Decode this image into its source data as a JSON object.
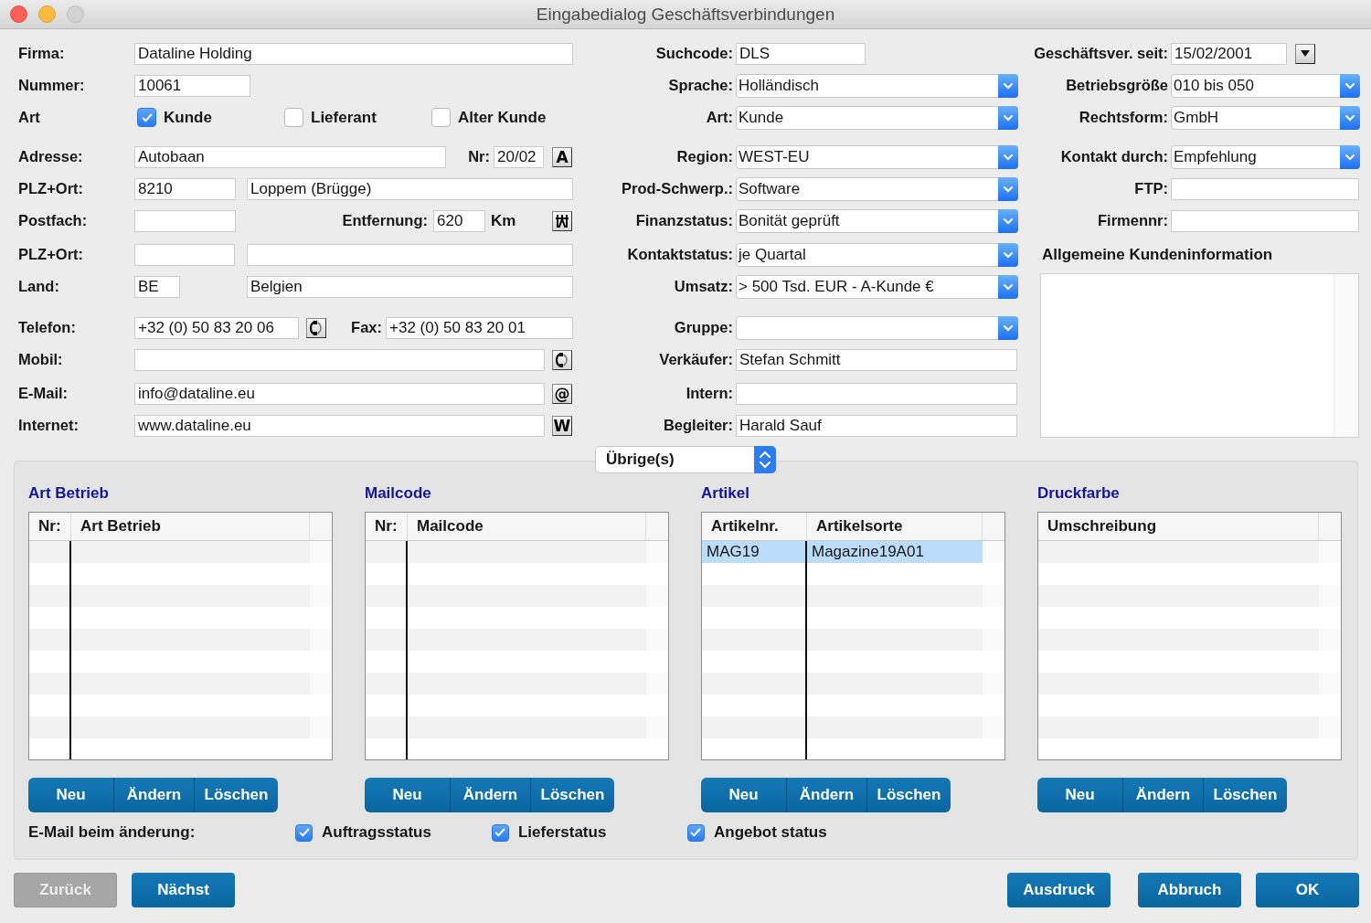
{
  "window": {
    "title": "Eingabedialog Geschäftsverbindungen"
  },
  "left": [
    {
      "items": [
        {
          "kind": "label",
          "text": "Firma:"
        },
        {
          "kind": "field",
          "value": "Dataline Holding"
        }
      ]
    },
    {
      "items": [
        {
          "kind": "label",
          "text": "Nummer:"
        },
        {
          "kind": "field",
          "value": "10061"
        }
      ]
    },
    {
      "items": [
        {
          "kind": "label",
          "text": "Art"
        },
        {
          "kind": "checkbox",
          "label": "Kunde",
          "checked": true
        },
        {
          "kind": "checkbox",
          "label": "Lieferant",
          "checked": false
        },
        {
          "kind": "checkbox",
          "label": "Alter Kunde",
          "checked": false
        }
      ]
    },
    {
      "items": [
        {
          "kind": "label",
          "text": "Adresse:"
        },
        {
          "kind": "field",
          "value": "Autobaan"
        },
        {
          "kind": "label",
          "text": "Nr:"
        },
        {
          "kind": "field",
          "value": "20/02"
        },
        {
          "kind": "glyph_button",
          "glyph": "A"
        }
      ]
    },
    {
      "items": [
        {
          "kind": "label",
          "text": "PLZ+Ort:"
        },
        {
          "kind": "field",
          "value": "8210"
        },
        {
          "kind": "field",
          "value": "Loppem (Brügge)"
        }
      ]
    },
    {
      "items": [
        {
          "kind": "label",
          "text": "Postfach:"
        },
        {
          "kind": "field"
        },
        {
          "kind": "label",
          "text": "Entfernung:"
        },
        {
          "kind": "field",
          "value": "620"
        },
        {
          "kind": "unit",
          "text": "Km"
        },
        {
          "kind": "route_button"
        }
      ]
    },
    {
      "items": [
        {
          "kind": "label",
          "text": "PLZ+Ort:"
        },
        {
          "kind": "field"
        },
        {
          "kind": "field"
        }
      ]
    },
    {
      "items": [
        {
          "kind": "label",
          "text": "Land:"
        },
        {
          "kind": "field",
          "value": "BE"
        },
        {
          "kind": "field",
          "value": "Belgien"
        }
      ]
    },
    {
      "items": [
        {
          "kind": "label",
          "text": "Telefon:"
        },
        {
          "kind": "field",
          "value": "+32 (0) 50 83 20 06"
        },
        {
          "kind": "phone_button"
        },
        {
          "kind": "label",
          "text": "Fax:"
        },
        {
          "kind": "field",
          "value": "+32 (0) 50 83 20 01"
        }
      ]
    },
    {
      "items": [
        {
          "kind": "label",
          "text": "Mobil:"
        },
        {
          "kind": "field"
        },
        {
          "kind": "phone_button"
        }
      ]
    },
    {
      "items": [
        {
          "kind": "label",
          "text": "E-Mail:"
        },
        {
          "kind": "field",
          "value": "info@dataline.eu"
        },
        {
          "kind": "glyph_button",
          "glyph": "@"
        }
      ]
    },
    {
      "items": [
        {
          "kind": "label",
          "text": "Internet:"
        },
        {
          "kind": "field",
          "value": "www.dataline.eu"
        },
        {
          "kind": "glyph_button",
          "glyph": "W"
        }
      ]
    }
  ],
  "middle": [
    {
      "label": "Suchcode:",
      "kind": "field",
      "value": "DLS"
    },
    {
      "label": "Sprache:",
      "kind": "combo",
      "value": "Holländisch"
    },
    {
      "label": "Art:",
      "kind": "combo",
      "value": "Kunde"
    },
    {
      "label": "Region:",
      "kind": "combo",
      "value": "WEST-EU"
    },
    {
      "label": "Prod-Schwerp.:",
      "kind": "combo",
      "value": "Software"
    },
    {
      "label": "Finanzstatus:",
      "kind": "combo",
      "value": "Bonität geprüft"
    },
    {
      "label": "Kontaktstatus:",
      "kind": "combo",
      "value": "je Quartal"
    },
    {
      "label": "Umsatz:",
      "kind": "combo",
      "value": "> 500 Tsd. EUR - A-Kunde €"
    },
    {
      "label": "Gruppe:",
      "kind": "combo"
    },
    {
      "label": "Verkäufer:",
      "kind": "field",
      "value": "Stefan Schmitt"
    },
    {
      "label": "Intern:",
      "kind": "field"
    },
    {
      "label": "Begleiter:",
      "kind": "field",
      "value": "Harald Sauf"
    }
  ],
  "right": [
    {
      "label": "Geschäftsver. seit:",
      "kind": "date",
      "value": "15/02/2001"
    },
    {
      "label": "Betriebsgröße",
      "kind": "combo",
      "value": "010 bis 050"
    },
    {
      "label": "Rechtsform:",
      "kind": "combo",
      "value": "GmbH"
    },
    {
      "label": "Kontakt durch:",
      "kind": "combo",
      "value": "Empfehlung"
    },
    {
      "label": "FTP:",
      "kind": "field"
    },
    {
      "label": "Firmennr:",
      "kind": "field"
    }
  ],
  "customer_info": {
    "heading": "Allgemeine Kundeninformation"
  },
  "section_selector": {
    "value": "Übrige(s)"
  },
  "lists": [
    {
      "title": "Art Betrieb",
      "columns": [
        "Nr:",
        "Art Betrieb"
      ],
      "buttons": [
        "Neu",
        "Ändern",
        "Löschen"
      ]
    },
    {
      "title": "Mailcode",
      "columns": [
        "Nr:",
        "Mailcode"
      ],
      "buttons": [
        "Neu",
        "Ändern",
        "Löschen"
      ]
    },
    {
      "title": "Artikel",
      "columns": [
        "Artikelnr.",
        "Artikelsorte"
      ],
      "rows": [
        {
          "cells": [
            "MAG19",
            "Magazine19A01"
          ],
          "selected": true
        }
      ],
      "buttons": [
        "Neu",
        "Ändern",
        "Löschen"
      ]
    },
    {
      "title": "Druckfarbe",
      "columns": [
        "Umschreibung"
      ],
      "buttons": [
        "Neu",
        "Ändern",
        "Löschen"
      ]
    }
  ],
  "email_on_change": {
    "label": "E-Mail beim änderung:",
    "options": [
      {
        "label": "Auftragsstatus",
        "checked": true
      },
      {
        "label": "Lieferstatus",
        "checked": true
      },
      {
        "label": "Angebot status",
        "checked": true
      }
    ]
  },
  "nav_buttons": [
    {
      "label": "Zurück",
      "disabled": true
    },
    {
      "label": "Nächst",
      "disabled": false
    }
  ],
  "action_buttons": [
    {
      "label": "Ausdruck",
      "disabled": false
    },
    {
      "label": "Abbruch",
      "disabled": false
    },
    {
      "label": "OK",
      "disabled": false
    }
  ]
}
